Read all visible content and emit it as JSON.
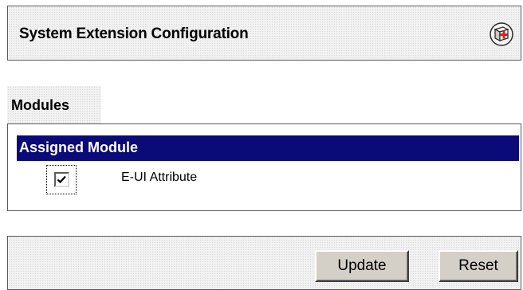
{
  "header": {
    "title": "System Extension Configuration",
    "help_icon": "help-book-icon"
  },
  "modules": {
    "tab_label": "Modules",
    "table_header": "Assigned Module",
    "rows": [
      {
        "checked": true,
        "label": "E-UI Attribute"
      }
    ]
  },
  "footer": {
    "update_label": "Update",
    "reset_label": "Reset"
  },
  "colors": {
    "table_header_bg": "#0a0a78",
    "panel_bg": "#f1f1f1",
    "button_face": "#d4d0c8"
  }
}
